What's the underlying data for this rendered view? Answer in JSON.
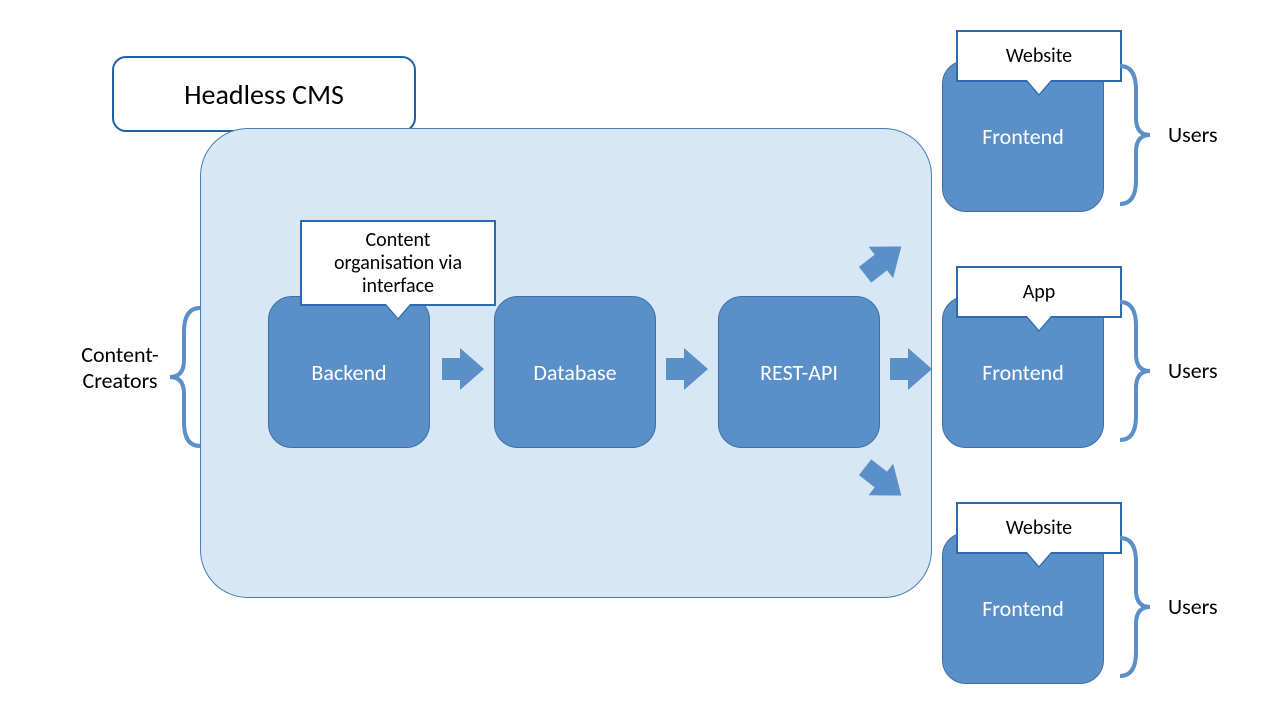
{
  "title": "Headless CMS",
  "left_actor": "Content-\nCreators",
  "callout_backend": "Content\norganisation via\ninterface",
  "nodes": {
    "backend": "Backend",
    "database": "Database",
    "restapi": "REST-API"
  },
  "frontends": [
    {
      "callout": "Website",
      "label": "Frontend",
      "users": "Users"
    },
    {
      "callout": "App",
      "label": "Frontend",
      "users": "Users"
    },
    {
      "callout": "Website",
      "label": "Frontend",
      "users": "Users"
    }
  ],
  "colors": {
    "fill": "#5a8fc7",
    "region": "#d7e7f5",
    "border": "#2e6bad"
  }
}
